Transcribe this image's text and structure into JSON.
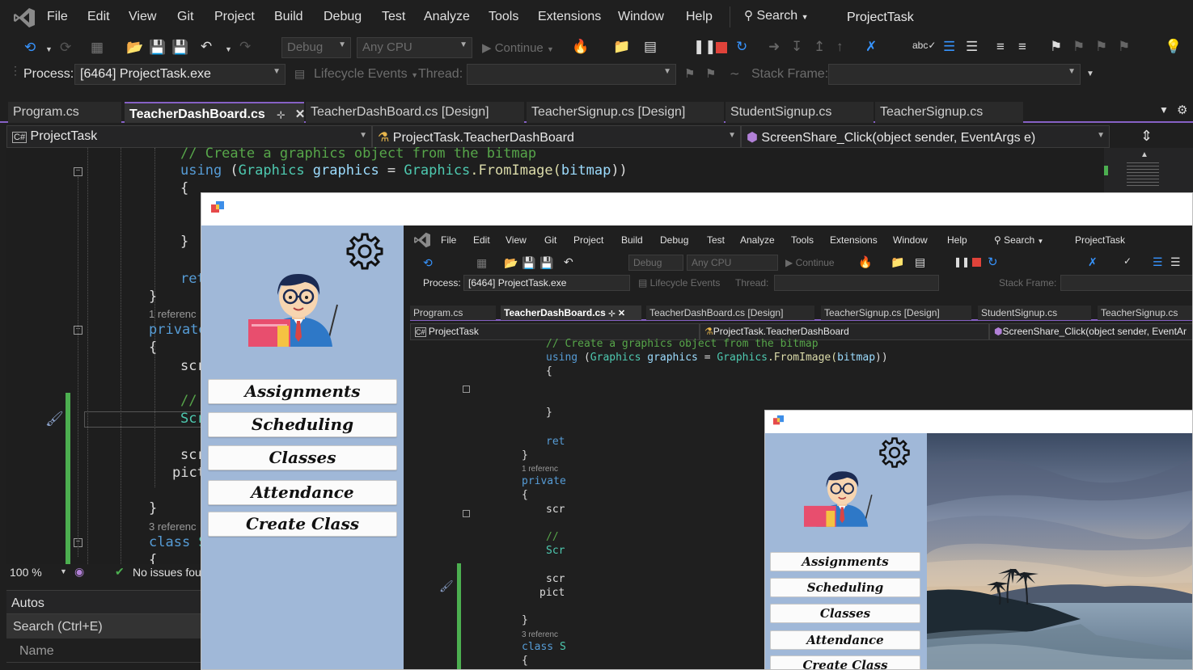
{
  "menu": [
    "File",
    "Edit",
    "View",
    "Git",
    "Project",
    "Build",
    "Debug",
    "Test",
    "Analyze",
    "Tools",
    "Extensions",
    "Window",
    "Help"
  ],
  "search_label": "Search",
  "solution_name": "ProjectTask",
  "toolbar": {
    "config": "Debug",
    "platform": "Any CPU",
    "continue_label": "Continue",
    "process_label": "Process:",
    "process_value": "[6464] ProjectTask.exe",
    "lifecycle_label": "Lifecycle Events",
    "thread_label": "Thread:",
    "stack_frame_label": "Stack Frame:"
  },
  "tabs": [
    "Program.cs",
    "TeacherDashBoard.cs",
    "TeacherDashBoard.cs [Design]",
    "TeacherSignup.cs [Design]",
    "StudentSignup.cs",
    "TeacherSignup.cs"
  ],
  "nav": {
    "project": "ProjectTask",
    "class": "ProjectTask.TeacherDashBoard",
    "member": "ScreenShare_Click(object sender, EventArgs e)",
    "member_short": "ScreenShare_Click(object sender, EventAr"
  },
  "code": {
    "comment_line": "// Create a graphics object from the bitmap",
    "using_kw": "using",
    "using_open": " (",
    "using_type": "Graphics",
    "using_var": " graphics",
    "using_eq": " = ",
    "using_cls": "Graphics",
    "using_call": ".FromImage(",
    "using_arg": "bitmap",
    "using_close": "))",
    "brace_open": "{",
    "brace_close": "}",
    "ret": "ret",
    "refs1": "1 referenc",
    "private": "private",
    "scr": "scr",
    "comment2": "//",
    "scr2": "Scr",
    "pict": "pict",
    "refs3": "3 referenc",
    "class_kw": "class",
    "class_rest": " S"
  },
  "status": {
    "zoom": "100 %",
    "issues": "No issues fou"
  },
  "panel": {
    "title": "Autos",
    "search": "Search (Ctrl+E)",
    "column": "Name"
  },
  "app_buttons": [
    "Assignments",
    "Scheduling",
    "Classes",
    "Attendance",
    "Create Class"
  ],
  "colors": {
    "vs_purple": "#8661c5",
    "sidebar_blue": "#a0b8d8",
    "keyword": "#569cd6",
    "comment": "#57a64a",
    "type": "#4ec9b0",
    "change_green": "#4caf50"
  }
}
